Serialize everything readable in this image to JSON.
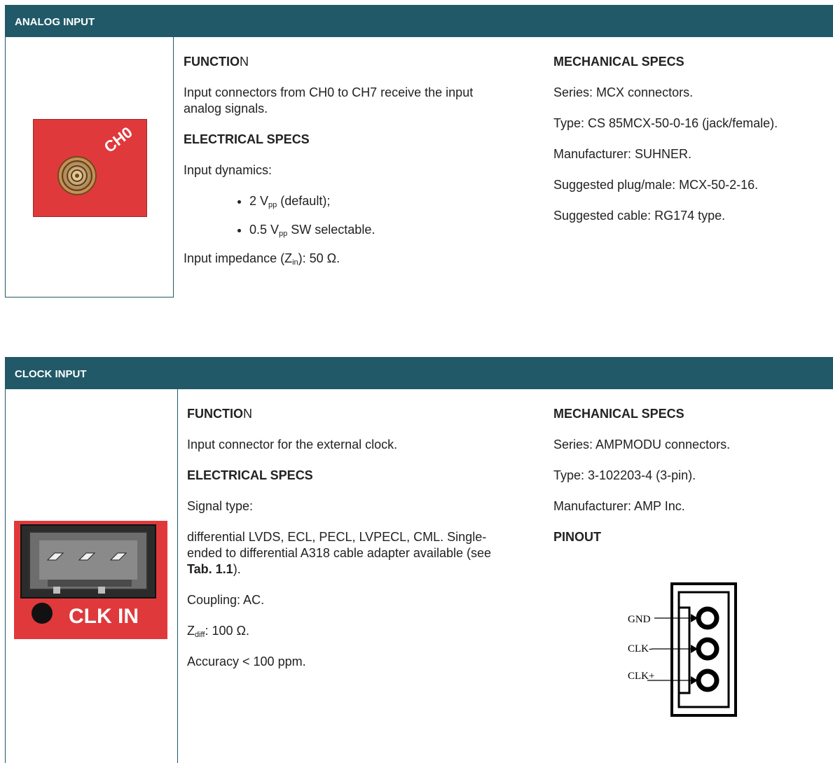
{
  "analog": {
    "header": "ANALOG INPUT",
    "connector_label": "CH0",
    "function_title": "FUNCTIO",
    "function_title_tail": "N",
    "function_text": "Input connectors from CH0 to CH7 receive the input analog signals.",
    "electrical_title": "ELECTRICAL SPECS",
    "dynamics_label": "Input dynamics:",
    "bullets": [
      {
        "pre": "2 V",
        "sub": "pp",
        "post": " (default);"
      },
      {
        "pre": "0.5 V",
        "sub": "pp",
        "post": " SW selectable."
      }
    ],
    "impedance_pre": "Input impedance (Z",
    "impedance_sub": "in",
    "impedance_post": "): 50 Ω.",
    "mechanical_title": "MECHANICAL SPECS",
    "mechanical": [
      "Series: MCX connectors.",
      "Type: CS 85MCX-50-0-16 (jack/female).",
      "Manufacturer: SUHNER.",
      "Suggested plug/male: MCX-50-2-16.",
      "Suggested cable: RG174 type."
    ]
  },
  "clock": {
    "header": "CLOCK INPUT",
    "connector_label": "CLK IN",
    "function_title": "FUNCTIO",
    "function_title_tail": "N",
    "function_text": "Input connector for the external clock.",
    "electrical_title": "ELECTRICAL SPECS",
    "signal_label": "Signal type:",
    "signal_text_1": "differential LVDS, ECL, PECL, LVPECL, CML. Single-ended to differential A318 cable adapter available (see ",
    "signal_ref": "Tab. 1.1",
    "signal_text_2": ").",
    "coupling": "Coupling: AC.",
    "zdiff_pre": "Z",
    "zdiff_sub": "diff",
    "zdiff_post": ": 100 Ω.",
    "accuracy": "Accuracy < 100 ppm.",
    "mechanical_title": "MECHANICAL SPECS",
    "mechanical": [
      "Series: AMPMODU connectors.",
      "Type: 3-102203-4 (3-pin).",
      "Manufacturer: AMP Inc."
    ],
    "pinout_title": "PINOUT",
    "pins": [
      "GND",
      "CLK-",
      "CLK+"
    ]
  },
  "colors": {
    "header_bg": "#215968",
    "board_red": "#e0393b"
  }
}
